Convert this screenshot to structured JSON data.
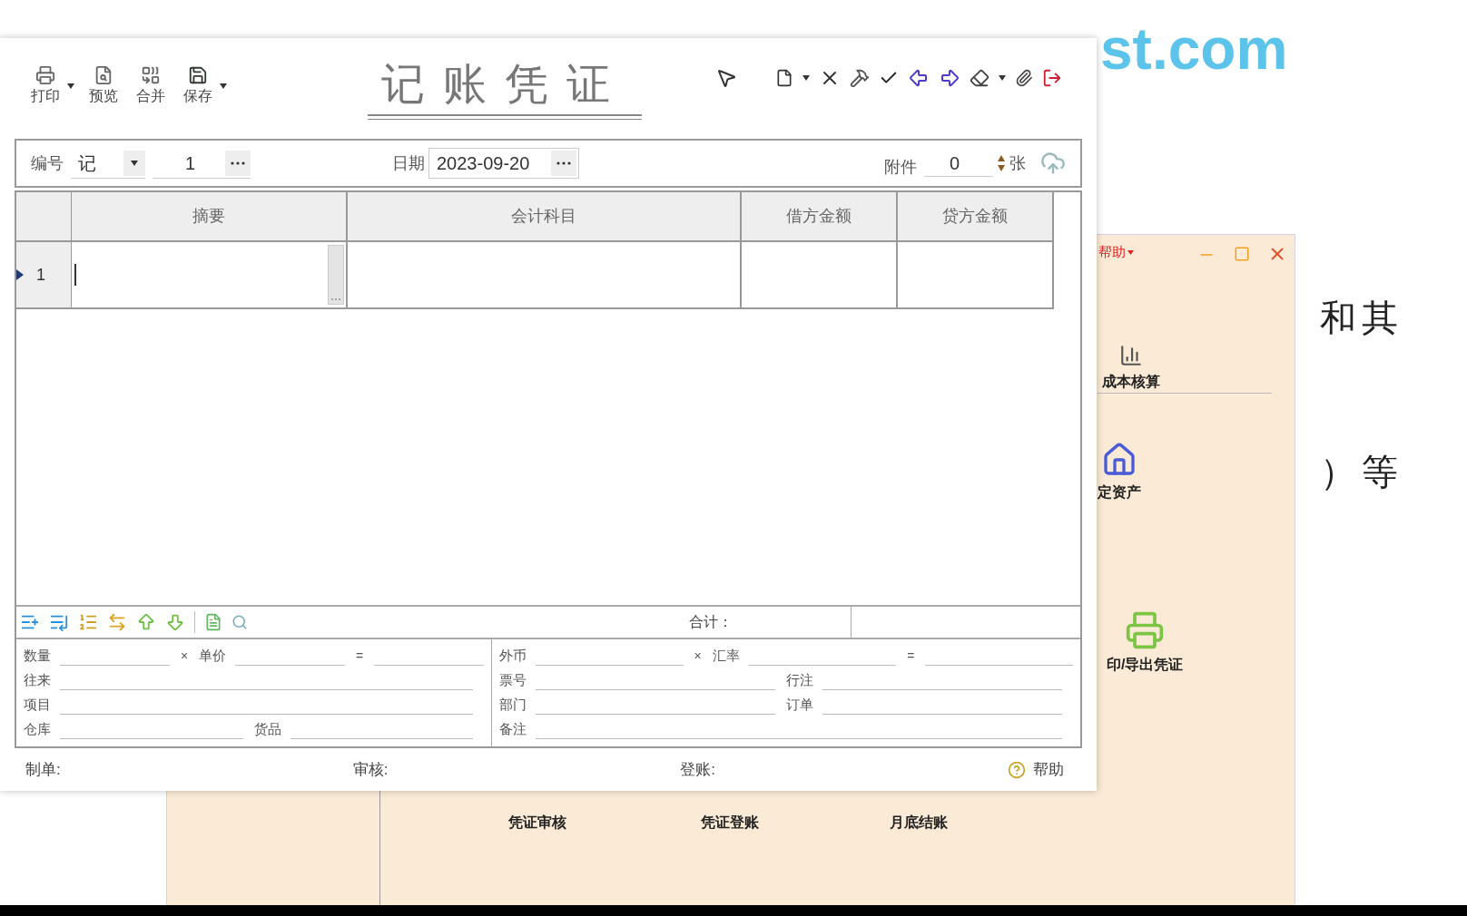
{
  "document": {
    "site": "st.com",
    "lines": [
      "和其",
      "）等"
    ]
  },
  "main_window": {
    "menu": "帮助",
    "items": [
      {
        "label": "成本核算"
      },
      {
        "label": "定资产"
      },
      {
        "label": "印/导出凭证"
      },
      {
        "label": "凭证审核"
      },
      {
        "label": "凭证登账"
      },
      {
        "label": "月底结账"
      }
    ]
  },
  "voucher": {
    "title": "记账凭证",
    "toolbar": [
      {
        "label": "打印",
        "dropdown": true
      },
      {
        "label": "预览",
        "dropdown": false
      },
      {
        "label": "合并",
        "dropdown": false
      },
      {
        "label": "保存",
        "dropdown": true
      }
    ],
    "header": {
      "number_label": "编号",
      "type": "记",
      "number": "1",
      "date_label": "日期",
      "date": "2023-09-20",
      "attachments_label": "附件",
      "attachments": "0",
      "attachments_unit": "张"
    },
    "columns": [
      "摘要",
      "会计科目",
      "借方金额",
      "贷方金额"
    ],
    "rows": [
      {
        "number": "1",
        "selected": true
      }
    ],
    "total_label": "合计：",
    "details_left": [
      [
        {
          "kind": "label",
          "text": "数量"
        },
        {
          "kind": "sign",
          "text": "×"
        },
        {
          "kind": "label",
          "text": "单价"
        },
        {
          "kind": "sign",
          "text": "="
        }
      ],
      [
        {
          "kind": "label",
          "text": "往来"
        }
      ],
      [
        {
          "kind": "label",
          "text": "项目"
        }
      ],
      [
        {
          "kind": "label",
          "text": "仓库"
        },
        {
          "kind": "label",
          "text": "货品"
        }
      ]
    ],
    "details_right": [
      [
        {
          "kind": "label",
          "text": "外币"
        },
        {
          "kind": "sign",
          "text": "×"
        },
        {
          "kind": "label",
          "text": "汇率"
        },
        {
          "kind": "sign",
          "text": "="
        }
      ],
      [
        {
          "kind": "label",
          "text": "票号"
        },
        {
          "kind": "label",
          "text": "行注"
        }
      ],
      [
        {
          "kind": "label",
          "text": "部门"
        },
        {
          "kind": "label",
          "text": "订单"
        }
      ],
      [
        {
          "kind": "label",
          "text": "备注"
        }
      ]
    ],
    "footer": [
      "制单:",
      "审核:",
      "登账:"
    ],
    "help": "帮助"
  }
}
